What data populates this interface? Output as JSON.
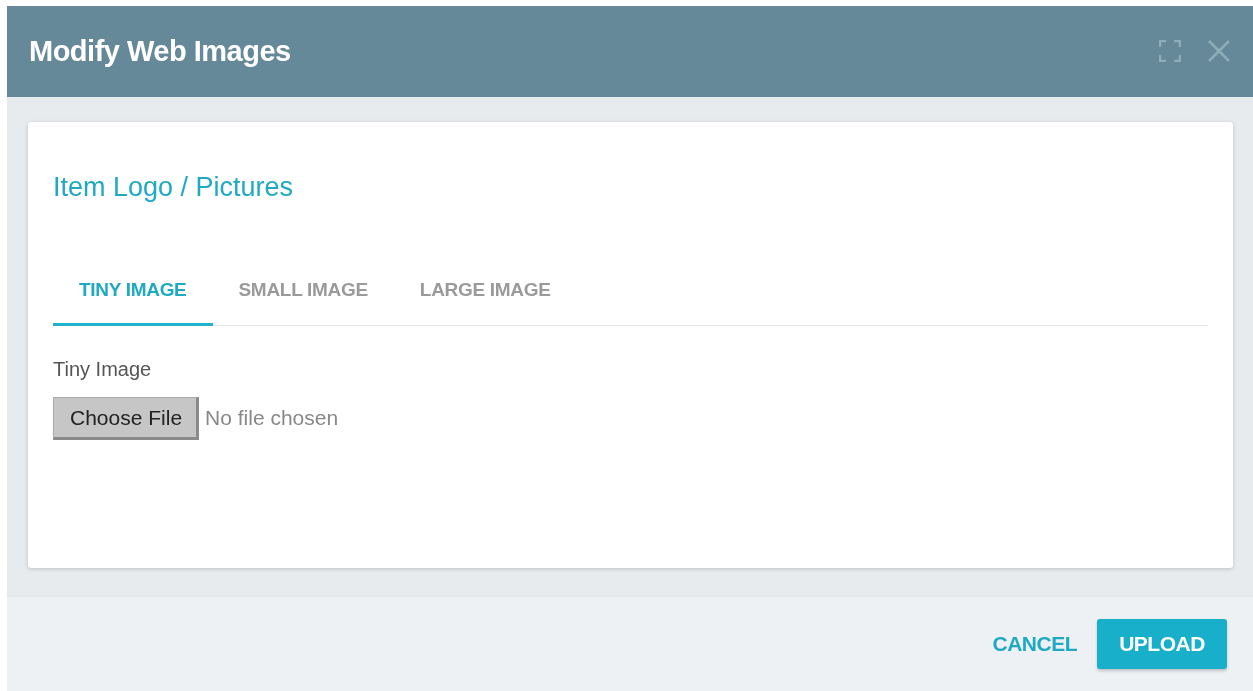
{
  "dialog": {
    "title": "Modify Web Images"
  },
  "section": {
    "title": "Item Logo / Pictures"
  },
  "tabs": [
    {
      "label": "TINY IMAGE",
      "selected": true
    },
    {
      "label": "SMALL IMAGE",
      "selected": false
    },
    {
      "label": "LARGE IMAGE",
      "selected": false
    }
  ],
  "field": {
    "label": "Tiny Image",
    "button": "Choose File",
    "status": "No file chosen"
  },
  "buttons": {
    "cancel": "CANCEL",
    "upload": "UPLOAD"
  }
}
